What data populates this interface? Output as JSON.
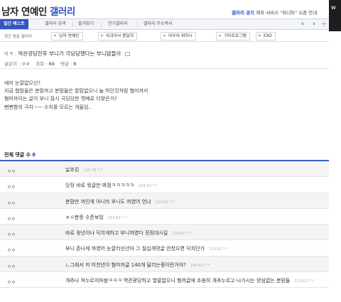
{
  "header": {
    "title_main": "남자 연예인",
    "title_accent": "갤러리",
    "notice_label": "갤러리 공지",
    "notice_text": "제휴 서비스 \"위너타\" 오픈 안내",
    "ad_text": "W"
  },
  "topnav": {
    "items": [
      "일간 베스트",
      "갤러리 검색",
      "즐겨찾기",
      "인기갤러리",
      "갤러리 주소복사"
    ],
    "arrow_left": "‹",
    "arrow_right": "›",
    "plus": "+"
  },
  "recent": {
    "label": "최근 방문 갤러리",
    "chips": [
      "남자 연예인",
      "외과의사 봉달희",
      "여우야 뭐하니",
      "기타프로그램",
      "EXO"
    ]
  },
  "post": {
    "category": "제 목 :",
    "title": "역관광당한후 부니가 극딩당했다는 부니맘들아",
    "author_label": "글쓴이 :",
    "author": "ㅇㅇ",
    "views_label": "조회 :",
    "views": "69",
    "comments_label": "댓글 :",
    "comments": "8",
    "body": [
      "애미 눈깔없으신?",
      "지금 협맘들은 분맘까고 분맘들은 할맘없으니 눌 하던것처럼 혐미까서",
      "혐미까이는 글이 부니 잠시 극딩당한 맷배로 더맞은거?",
      "뻔뻔함의 극치ㅡㅡ 수치를 모르는 개들임.."
    ]
  },
  "comments_section": {
    "label": "전체 댓글 수",
    "count": "8",
    "rows": [
      {
        "nick": "ㅇㅇ",
        "text": "날조킹",
        "ip": "110.70.*.*"
      },
      {
        "nick": "ㅇㅇ",
        "text": "당장 바로 윗글만 봐껌ㅋㅋㅋㅋㅋ",
        "ip": "223.62.*.*"
      },
      {
        "nick": "ㅇㅇ",
        "text": "분맘만 까인게 아니라 부니도 까였어 언냐",
        "ip": "223.62.*.*"
      },
      {
        "nick": "ㅇㅇ",
        "text": "ㅊㅇ분증 수준보임",
        "ip": "223.62.*.*"
      },
      {
        "nick": "ㅇㅇ",
        "text": "바로 윗년이나 닥치게하고 부니까였다 징징대시길",
        "ip": "223.62.*.*"
      },
      {
        "nick": "ㅇㅇ",
        "text": "부니 존나게 까였어 눈깔리신년아 그 칠십개댓글 안찼으면 닥치던가",
        "ip": "223.62.*.*"
      },
      {
        "nick": "ㅇㅇ",
        "text": "ㄴ그래서 저 미친년이 혐미까글 140개 달리는중이란거야?",
        "ip": "223.62.*.*"
      },
      {
        "nick": "ㅇㅇ",
        "text": "개추나 쳐누르지마쌈ㅋㅋㅋ 역관광당하고 할말없으니 혐까글에 조용히 개추누르고 나가시는 양심없는 분맘들",
        "ip": "223.62.*.*"
      }
    ]
  },
  "colors": {
    "accent": "#2b53c8",
    "nav_active": "#3155c3"
  }
}
